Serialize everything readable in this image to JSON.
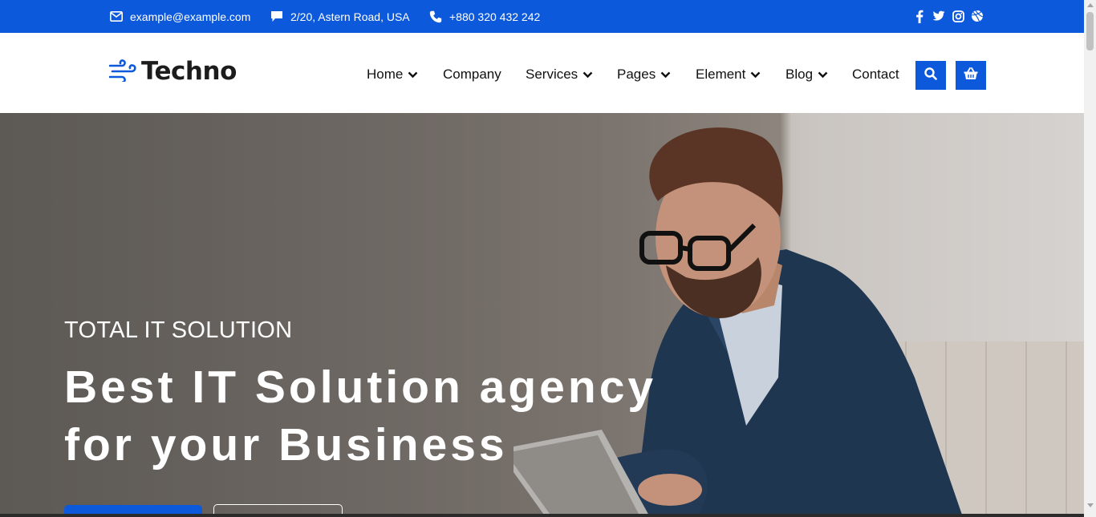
{
  "topbar": {
    "email": "example@example.com",
    "address": "2/20, Astern Road, USA",
    "phone": "+880 320 432 242",
    "social": [
      "facebook-icon",
      "twitter-icon",
      "instagram-icon",
      "dribbble-icon"
    ]
  },
  "header": {
    "logo_text": "Techno",
    "nav": [
      {
        "label": "Home",
        "has_dropdown": true
      },
      {
        "label": "Company",
        "has_dropdown": false
      },
      {
        "label": "Services",
        "has_dropdown": true
      },
      {
        "label": "Pages",
        "has_dropdown": true
      },
      {
        "label": "Element",
        "has_dropdown": true
      },
      {
        "label": "Blog",
        "has_dropdown": true
      },
      {
        "label": "Contact",
        "has_dropdown": false
      }
    ],
    "buttons": [
      "search-icon",
      "cart-icon"
    ]
  },
  "hero": {
    "subtitle": "TOTAL IT SOLUTION",
    "title_line1": "Best IT Solution agency",
    "title_line2": "for your Business"
  },
  "colors": {
    "brand_blue": "#0d59db",
    "text_dark": "#111111",
    "white": "#ffffff"
  }
}
